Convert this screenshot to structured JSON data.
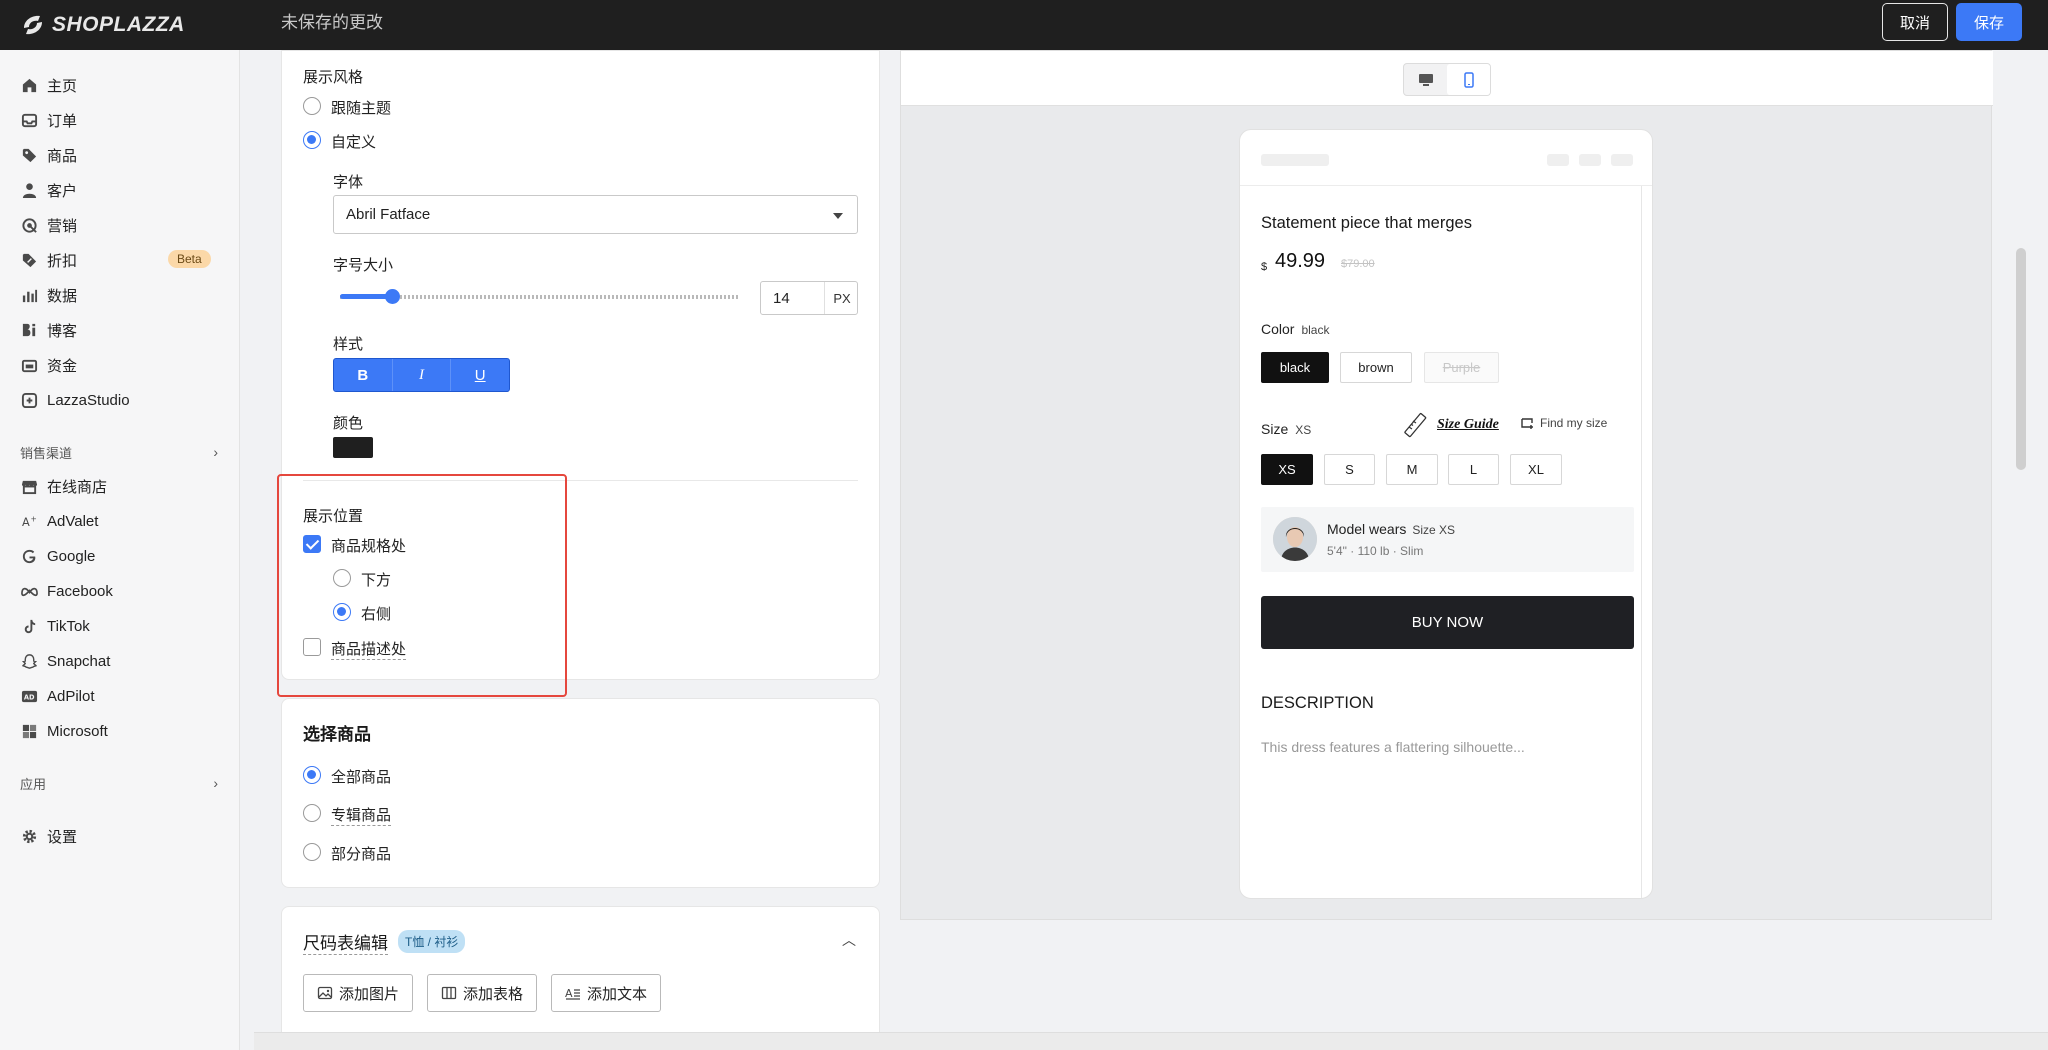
{
  "topbar": {
    "logo_text": "SHOPLAZZA",
    "unsaved_text": "未保存的更改",
    "cancel_label": "取消",
    "save_label": "保存"
  },
  "sidebar": {
    "items": [
      {
        "label": "主页",
        "icon": "home-icon"
      },
      {
        "label": "订单",
        "icon": "inbox-icon"
      },
      {
        "label": "商品",
        "icon": "tag-icon"
      },
      {
        "label": "客户",
        "icon": "person-icon"
      },
      {
        "label": "营销",
        "icon": "target-icon"
      },
      {
        "label": "折扣",
        "icon": "discount-icon",
        "badge": "Beta"
      },
      {
        "label": "数据",
        "icon": "bar-chart-icon"
      },
      {
        "label": "博客",
        "icon": "blog-icon"
      },
      {
        "label": "资金",
        "icon": "wallet-icon"
      },
      {
        "label": "LazzaStudio",
        "icon": "studio-icon"
      }
    ],
    "sales_channels_label": "销售渠道",
    "channels": [
      {
        "label": "在线商店",
        "icon": "store-icon"
      },
      {
        "label": "AdValet",
        "icon": "advalet-icon"
      },
      {
        "label": "Google",
        "icon": "google-icon"
      },
      {
        "label": "Facebook",
        "icon": "meta-icon"
      },
      {
        "label": "TikTok",
        "icon": "tiktok-icon"
      },
      {
        "label": "Snapchat",
        "icon": "snapchat-icon"
      },
      {
        "label": "AdPilot",
        "icon": "adpilot-icon"
      },
      {
        "label": "Microsoft",
        "icon": "microsoft-icon"
      }
    ],
    "apps_label": "应用",
    "settings_label": "设置"
  },
  "settings": {
    "display_style": {
      "title": "展示风格",
      "options": [
        "跟随主题",
        "自定义"
      ],
      "selected": "自定义"
    },
    "font": {
      "label": "字体",
      "value": "Abril Fatface"
    },
    "font_size": {
      "label": "字号大小",
      "value": "14",
      "unit": "PX",
      "slider_fraction": 0.13
    },
    "style": {
      "label": "样式",
      "buttons": [
        "B",
        "I",
        "U"
      ]
    },
    "color": {
      "label": "颜色",
      "value": "#1f1f1f"
    },
    "display_position": {
      "title": "展示位置",
      "spec_label": "商品规格处",
      "spec_checked": true,
      "sub_options": [
        "下方",
        "右侧"
      ],
      "sub_selected": "右侧",
      "desc_label": "商品描述处",
      "desc_checked": false
    },
    "select_products": {
      "title": "选择商品",
      "options": [
        "全部商品",
        "专辑商品",
        "部分商品"
      ],
      "selected": "全部商品"
    },
    "size_chart": {
      "title": "尺码表编辑",
      "tag": "T恤 / 衬衫",
      "buttons": [
        "添加图片",
        "添加表格",
        "添加文本"
      ]
    }
  },
  "preview": {
    "product_title": "Statement piece that merges",
    "currency": "$",
    "price": "49.99",
    "old_price": "$79.00",
    "color_label": "Color",
    "color_selected": "black",
    "colors": [
      "black",
      "brown",
      "Purple"
    ],
    "size_label": "Size",
    "size_selected": "XS",
    "size_guide": "Size Guide",
    "find_my_size": "Find my size",
    "sizes": [
      "XS",
      "S",
      "M",
      "L",
      "XL"
    ],
    "model_wears": "Model wears",
    "model_size": "Size XS",
    "model_meta": "5'4\" · 110 lb · Slim",
    "buy_now": "BUY NOW",
    "description_title": "DESCRIPTION",
    "description_text": "This dress features a flattering silhouette..."
  },
  "colors": {
    "accent": "#3c79f6",
    "topbar": "#1f1f1f",
    "highlight": "#e5473d"
  }
}
